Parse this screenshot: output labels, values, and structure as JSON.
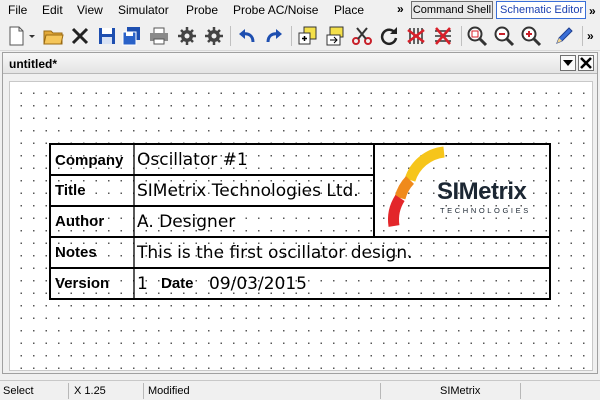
{
  "menubar": {
    "items": [
      "File",
      "Edit",
      "View",
      "Simulator",
      "Probe",
      "Probe AC/Noise",
      "Place"
    ],
    "overflow": "»",
    "command_shell": "Command Shell",
    "editor_select": "Schematic Editor",
    "overflow_right": "»"
  },
  "toolbar": {
    "icons": [
      "new-document-icon",
      "dropdown-arrow-icon",
      "open-folder-icon",
      "close-x-icon",
      "save-icon",
      "save-all-icon",
      "print-icon",
      "settings-gear-icon",
      "settings-gear-alt-icon",
      "undo-icon",
      "redo-icon",
      "add-to-group-icon",
      "insert-block-icon",
      "cut-scissors-icon",
      "rotate-icon",
      "delete-wires-icon",
      "delete-selected-icon",
      "zoom-fit-icon",
      "zoom-out-icon",
      "zoom-in-icon",
      "edit-pencil-icon"
    ],
    "overflow": "»",
    "accent": "#2a5fc4"
  },
  "document": {
    "title": "untitled*"
  },
  "title_block": {
    "company_label": "Company",
    "company_value": "Oscillator #1",
    "title_label": "Title",
    "title_value": "SIMetrix Technologies Ltd.",
    "author_label": "Author",
    "author_value": "A. Designer",
    "notes_label": "Notes",
    "notes_value": "This is the first oscillator design.",
    "version_label": "Version",
    "version_value": "1",
    "date_label": "Date",
    "date_value": "09/03/2015",
    "logo_wordmark": "SIMetrix",
    "logo_tagline": "TECHNOLOGIES",
    "logo_colors": {
      "red": "#e3262a",
      "orange": "#f08a1c",
      "yellow": "#f6c51a"
    }
  },
  "statusbar": {
    "mode": "Select",
    "zoom": "X 1.25",
    "state": "Modified",
    "app": "SIMetrix"
  }
}
